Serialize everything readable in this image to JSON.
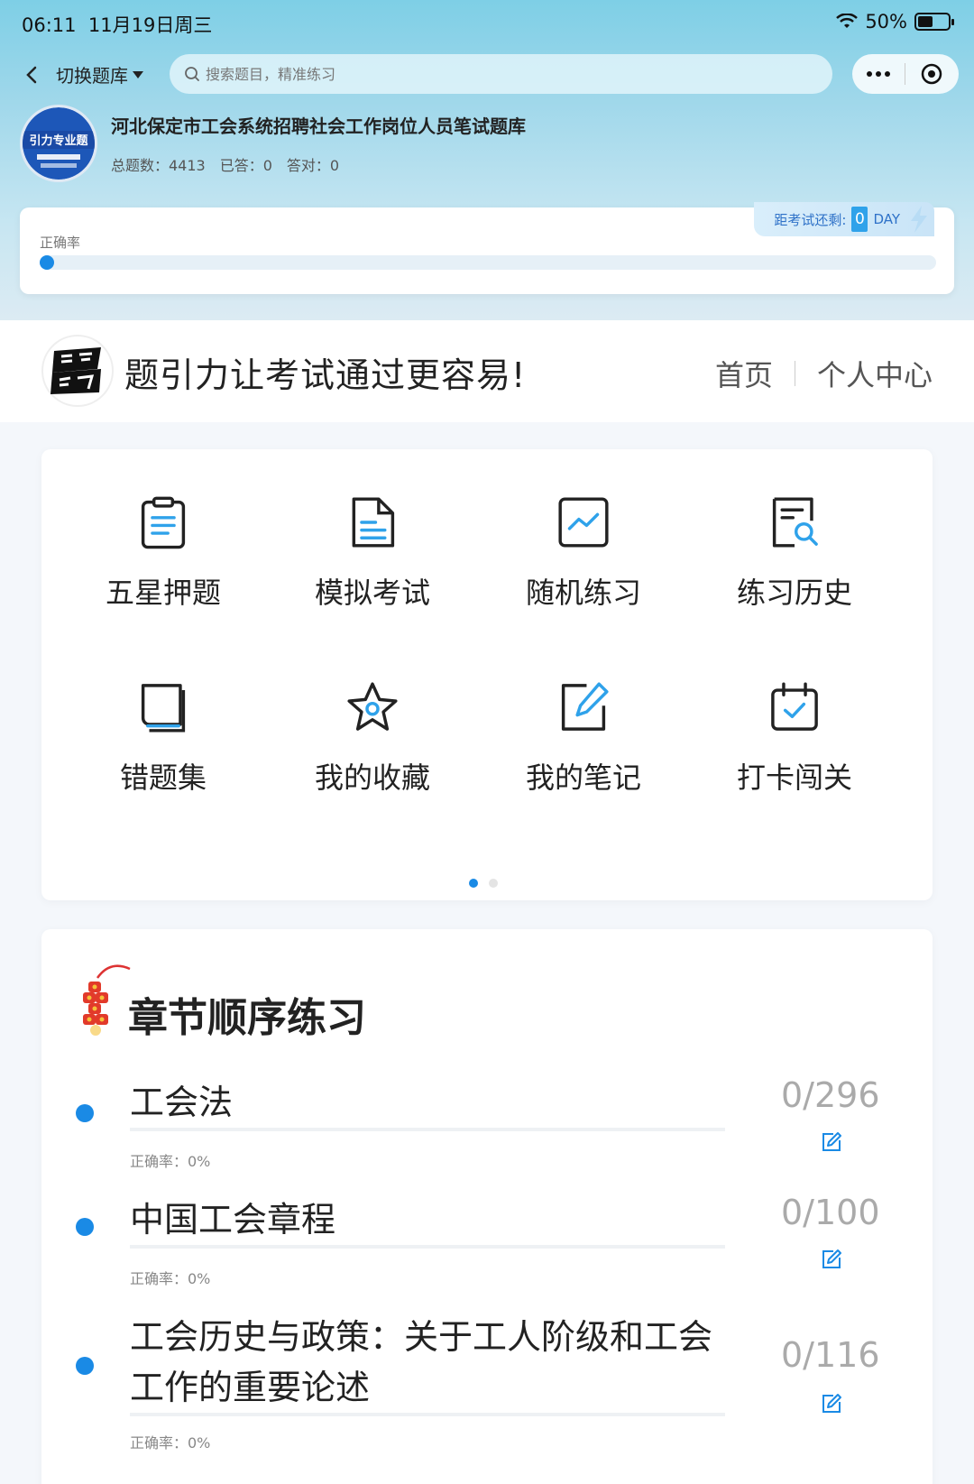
{
  "status_bar": {
    "time": "06:11",
    "date": "11月19日周三",
    "battery": "50%"
  },
  "nav": {
    "switch_label": "切换题库",
    "search_placeholder": "搜索题目，精准练习"
  },
  "library": {
    "badge_text": "引力专业题",
    "title": "河北保定市工会系统招聘社会工作岗位人员笔试题库",
    "total_label": "总题数：4413",
    "answered_label": "已答：0",
    "correct_label": "答对：0"
  },
  "accuracy": {
    "label": "正确率",
    "value": 0,
    "countdown_label": "距考试还剩:",
    "countdown_value": "0",
    "countdown_unit": "DAY"
  },
  "banner": {
    "slogan": "题引力让考试通过更容易!",
    "nav_home": "首页",
    "nav_personal": "个人中心"
  },
  "grid": [
    {
      "label": "五星押题",
      "icon": "clipboard-icon"
    },
    {
      "label": "模拟考试",
      "icon": "document-icon"
    },
    {
      "label": "随机练习",
      "icon": "trend-chart-icon"
    },
    {
      "label": "练习历史",
      "icon": "search-document-icon"
    },
    {
      "label": "错题集",
      "icon": "book-icon"
    },
    {
      "label": "我的收藏",
      "icon": "star-icon"
    },
    {
      "label": "我的笔记",
      "icon": "edit-note-icon"
    },
    {
      "label": "打卡闯关",
      "icon": "calendar-check-icon"
    }
  ],
  "chapters": {
    "title": "章节顺序练习",
    "items": [
      {
        "name": "工会法",
        "count": "0/296",
        "accuracy": "正确率：0%"
      },
      {
        "name": "中国工会章程",
        "count": "0/100",
        "accuracy": "正确率：0%"
      },
      {
        "name": "工会历史与政策：关于工人阶级和工会工作的重要论述",
        "count": "0/116",
        "accuracy": "正确率：0%"
      }
    ]
  },
  "colors": {
    "accent": "#1a8ae5",
    "icon": "#2fa2ea",
    "dark": "#222222"
  }
}
